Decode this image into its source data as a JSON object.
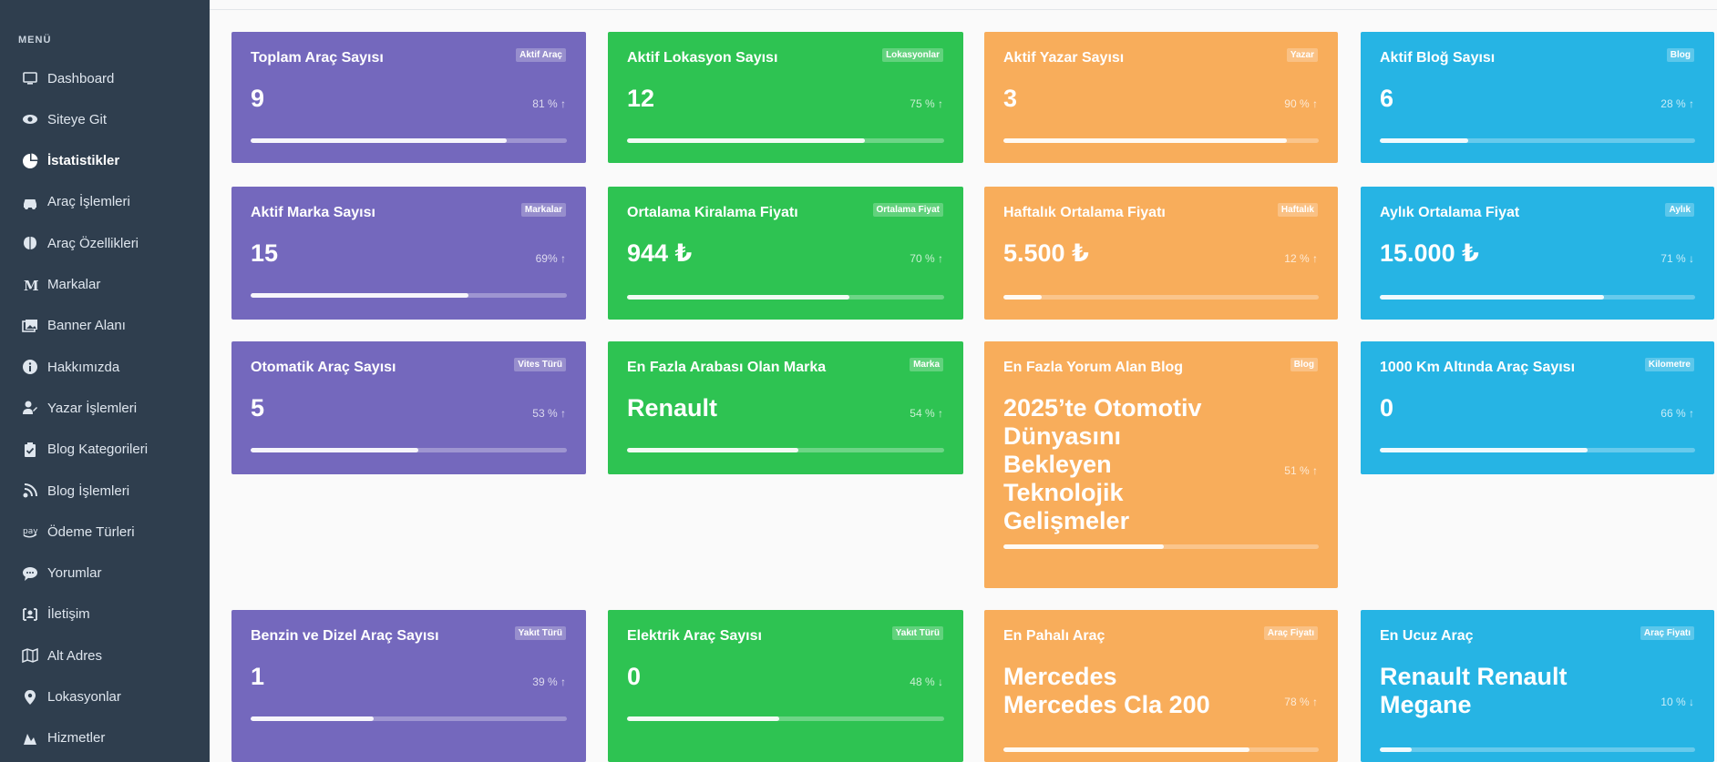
{
  "sidebar": {
    "menu_title": "MENÜ",
    "items": [
      {
        "label": "Dashboard",
        "icon": "monitor-icon"
      },
      {
        "label": "Siteye Git",
        "icon": "eye-icon"
      },
      {
        "label": "İstatistikler",
        "icon": "pie-chart-icon",
        "active": true
      },
      {
        "label": "Araç İşlemleri",
        "icon": "car-icon"
      },
      {
        "label": "Araç Özellikleri",
        "icon": "brain-icon"
      },
      {
        "label": "Markalar",
        "icon": "m-letter-icon"
      },
      {
        "label": "Banner Alanı",
        "icon": "images-icon"
      },
      {
        "label": "Hakkımızda",
        "icon": "info-icon"
      },
      {
        "label": "Yazar İşlemleri",
        "icon": "user-edit-icon"
      },
      {
        "label": "Blog Kategorileri",
        "icon": "clipboard-check-icon"
      },
      {
        "label": "Blog İşlemleri",
        "icon": "blog-icon"
      },
      {
        "label": "Ödeme Türleri",
        "icon": "amazon-pay-icon"
      },
      {
        "label": "Yorumlar",
        "icon": "comment-icon"
      },
      {
        "label": "İletişim",
        "icon": "contact-card-icon"
      },
      {
        "label": "Alt Adres",
        "icon": "map-icon"
      },
      {
        "label": "Lokasyonlar",
        "icon": "map-marker-icon"
      },
      {
        "label": "Hizmetler",
        "icon": "service-icon"
      }
    ]
  },
  "colors": {
    "sidebar_bg": "#2f3e4e",
    "purple": "#7468bd",
    "green": "#2ec352",
    "orange": "#f8ad5b",
    "blue": "#26b4e4"
  },
  "cards": [
    {
      "title": "Toplam Araç Sayısı",
      "badge": "Aktif Araç",
      "value": "9",
      "percent_label": "81 %",
      "trend": "up",
      "progress": 0.81,
      "color": "purple"
    },
    {
      "title": "Aktif Lokasyon Sayısı",
      "badge": "Lokasyonlar",
      "value": "12",
      "percent_label": "75 %",
      "trend": "up",
      "progress": 0.75,
      "color": "green"
    },
    {
      "title": "Aktif Yazar Sayısı",
      "badge": "Yazar",
      "value": "3",
      "percent_label": "90 %",
      "trend": "up",
      "progress": 0.9,
      "color": "orange"
    },
    {
      "title": "Aktif Bloğ Sayısı",
      "badge": "Blog",
      "value": "6",
      "percent_label": "28 %",
      "trend": "up",
      "progress": 0.28,
      "color": "blue"
    },
    {
      "title": "Aktif Marka Sayısı",
      "badge": "Markalar",
      "value": "15",
      "percent_label": "69%",
      "trend": "up",
      "progress": 0.69,
      "color": "purple"
    },
    {
      "title": "Ortalama Kiralama Fiyatı",
      "badge": "Ortalama Fiyat",
      "value": "944 ₺",
      "percent_label": "70 %",
      "trend": "up",
      "progress": 0.7,
      "color": "green"
    },
    {
      "title": "Haftalık Ortalama Fiyatı",
      "badge": "Haftalık",
      "value": "5.500 ₺",
      "percent_label": "12 %",
      "trend": "up",
      "progress": 0.12,
      "color": "orange"
    },
    {
      "title": "Aylık Ortalama Fiyat",
      "badge": "Aylık",
      "value": "15.000 ₺",
      "percent_label": "71 %",
      "trend": "down",
      "progress": 0.71,
      "color": "blue"
    },
    {
      "title": "Otomatik Araç Sayısı",
      "badge": "Vites Türü",
      "value": "5",
      "percent_label": "53 %",
      "trend": "up",
      "progress": 0.53,
      "color": "purple"
    },
    {
      "title": "En Fazla Arabası Olan Marka",
      "badge": "Marka",
      "value": "Renault",
      "percent_label": "54 %",
      "trend": "up",
      "progress": 0.54,
      "color": "green"
    },
    {
      "title": "En Fazla Yorum Alan Blog",
      "badge": "Blog",
      "value": "2025’te Otomotiv Dünyasını Bekleyen Teknolojik Gelişmeler",
      "percent_label": "51 %",
      "trend": "up",
      "progress": 0.51,
      "color": "orange"
    },
    {
      "title": "1000 Km Altında Araç Sayısı",
      "badge": "Kilometre",
      "value": "0",
      "percent_label": "66 %",
      "trend": "up",
      "progress": 0.66,
      "color": "blue"
    },
    {
      "title": "Benzin ve Dizel Araç Sayısı",
      "badge": "Yakıt Türü",
      "value": "1",
      "percent_label": "39 %",
      "trend": "up",
      "progress": 0.39,
      "color": "purple"
    },
    {
      "title": "Elektrik Araç Sayısı",
      "badge": "Yakıt Türü",
      "value": "0",
      "percent_label": "48 %",
      "trend": "down",
      "progress": 0.48,
      "color": "green"
    },
    {
      "title": "En Pahalı Araç",
      "badge": "Araç Fiyatı",
      "value": "Mercedes Mercedes Cla 200",
      "percent_label": "78 %",
      "trend": "up",
      "progress": 0.78,
      "color": "orange"
    },
    {
      "title": "En Ucuz Araç",
      "badge": "Araç Fiyatı",
      "value": "Renault Renault Megane",
      "percent_label": "10 %",
      "trend": "down",
      "progress": 0.1,
      "color": "blue"
    }
  ]
}
